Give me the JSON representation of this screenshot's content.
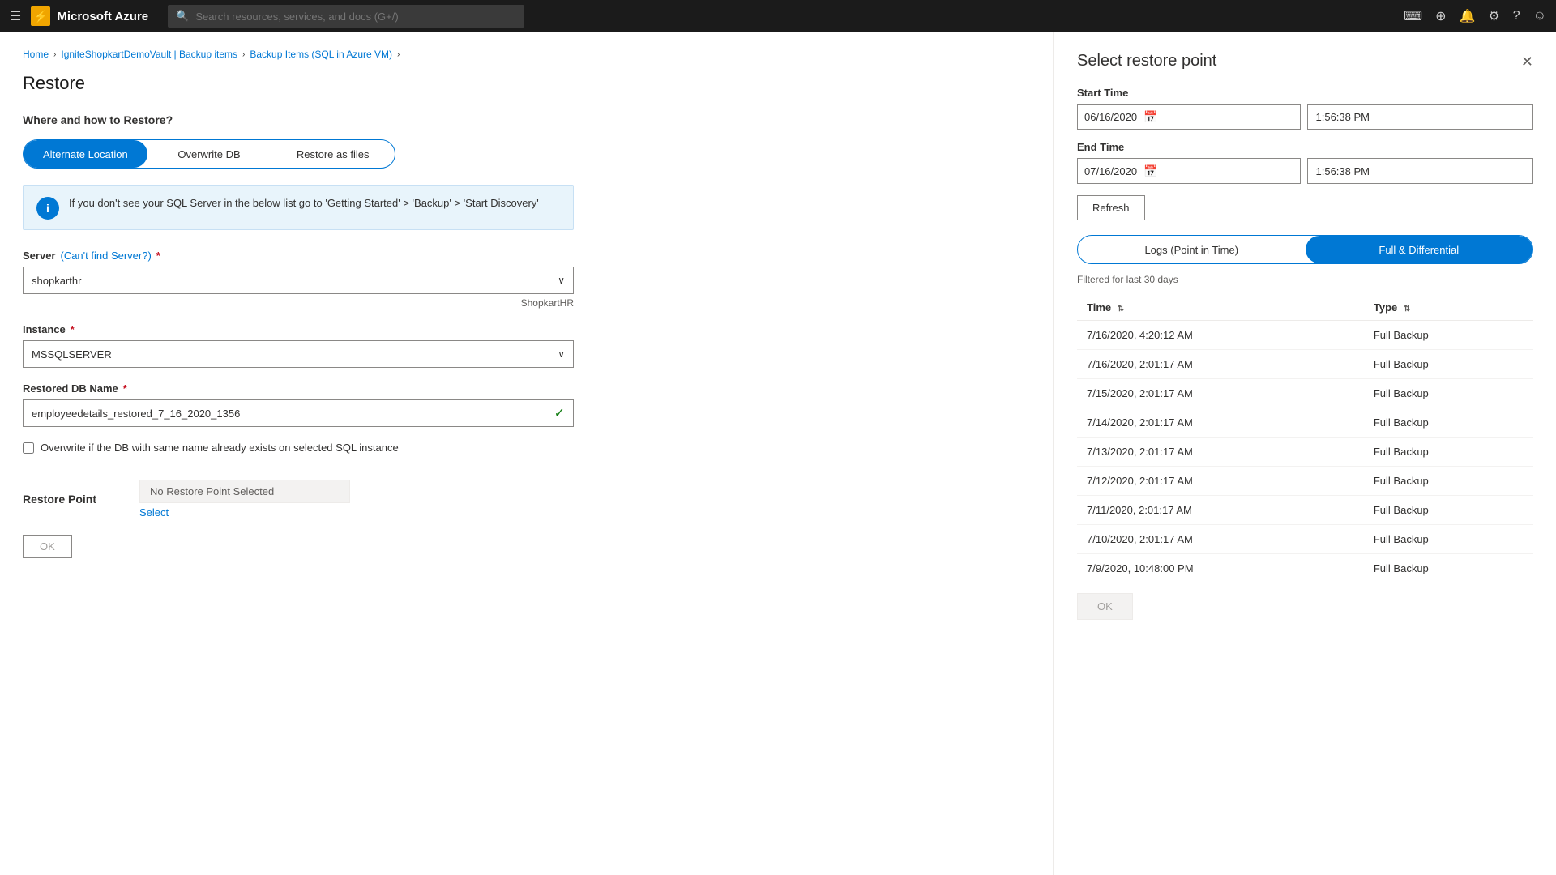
{
  "topNav": {
    "hamburger": "☰",
    "brandName": "Microsoft Azure",
    "brandIcon": "⚡",
    "searchPlaceholder": "Search resources, services, and docs (G+/)",
    "icons": [
      "terminal",
      "download",
      "bell",
      "settings",
      "help",
      "smiley"
    ]
  },
  "breadcrumb": {
    "items": [
      "Home",
      "IgniteShopkartDemoVault | Backup items",
      "Backup Items (SQL in Azure VM)"
    ]
  },
  "restore": {
    "pageTitle": "Restore",
    "sectionHeading": "Where and how to Restore?",
    "toggleOptions": [
      "Alternate Location",
      "Overwrite DB",
      "Restore as files"
    ],
    "activeToggle": 0,
    "infoText": "If you don't see your SQL Server in the below list go to 'Getting Started' > 'Backup' > 'Start Discovery'",
    "serverLabel": "Server",
    "serverLink": "(Can't find Server?)",
    "serverValue": "shopkarthr",
    "serverHint": "ShopkartHR",
    "instanceLabel": "Instance",
    "instanceValue": "MSSQLSERVER",
    "dbNameLabel": "Restored DB Name",
    "dbNameValue": "employeedetails_restored_7_16_2020_1356",
    "checkboxLabel": "Overwrite if the DB with same name already exists on selected SQL instance",
    "restorePointLabel": "Restore Point",
    "restorePointValue": "No Restore Point Selected",
    "selectLabel": "Select",
    "okLabel": "OK"
  },
  "panel": {
    "title": "Select restore point",
    "closeIcon": "✕",
    "startTimeLabel": "Start Time",
    "startDate": "06/16/2020",
    "startTime": "1:56:38 PM",
    "endTimeLabel": "End Time",
    "endDate": "07/16/2020",
    "endTime": "1:56:38 PM",
    "refreshLabel": "Refresh",
    "tabs": [
      "Logs (Point in Time)",
      "Full & Differential"
    ],
    "activeTab": 1,
    "filterText": "Filtered for last 30 days",
    "tableHeaders": [
      "Time",
      "Type"
    ],
    "tableRows": [
      {
        "time": "7/16/2020, 4:20:12 AM",
        "type": "Full Backup"
      },
      {
        "time": "7/16/2020, 2:01:17 AM",
        "type": "Full Backup"
      },
      {
        "time": "7/15/2020, 2:01:17 AM",
        "type": "Full Backup"
      },
      {
        "time": "7/14/2020, 2:01:17 AM",
        "type": "Full Backup"
      },
      {
        "time": "7/13/2020, 2:01:17 AM",
        "type": "Full Backup"
      },
      {
        "time": "7/12/2020, 2:01:17 AM",
        "type": "Full Backup"
      },
      {
        "time": "7/11/2020, 2:01:17 AM",
        "type": "Full Backup"
      },
      {
        "time": "7/10/2020, 2:01:17 AM",
        "type": "Full Backup"
      },
      {
        "time": "7/9/2020, 10:48:00 PM",
        "type": "Full Backup"
      }
    ],
    "okLabel": "OK"
  }
}
